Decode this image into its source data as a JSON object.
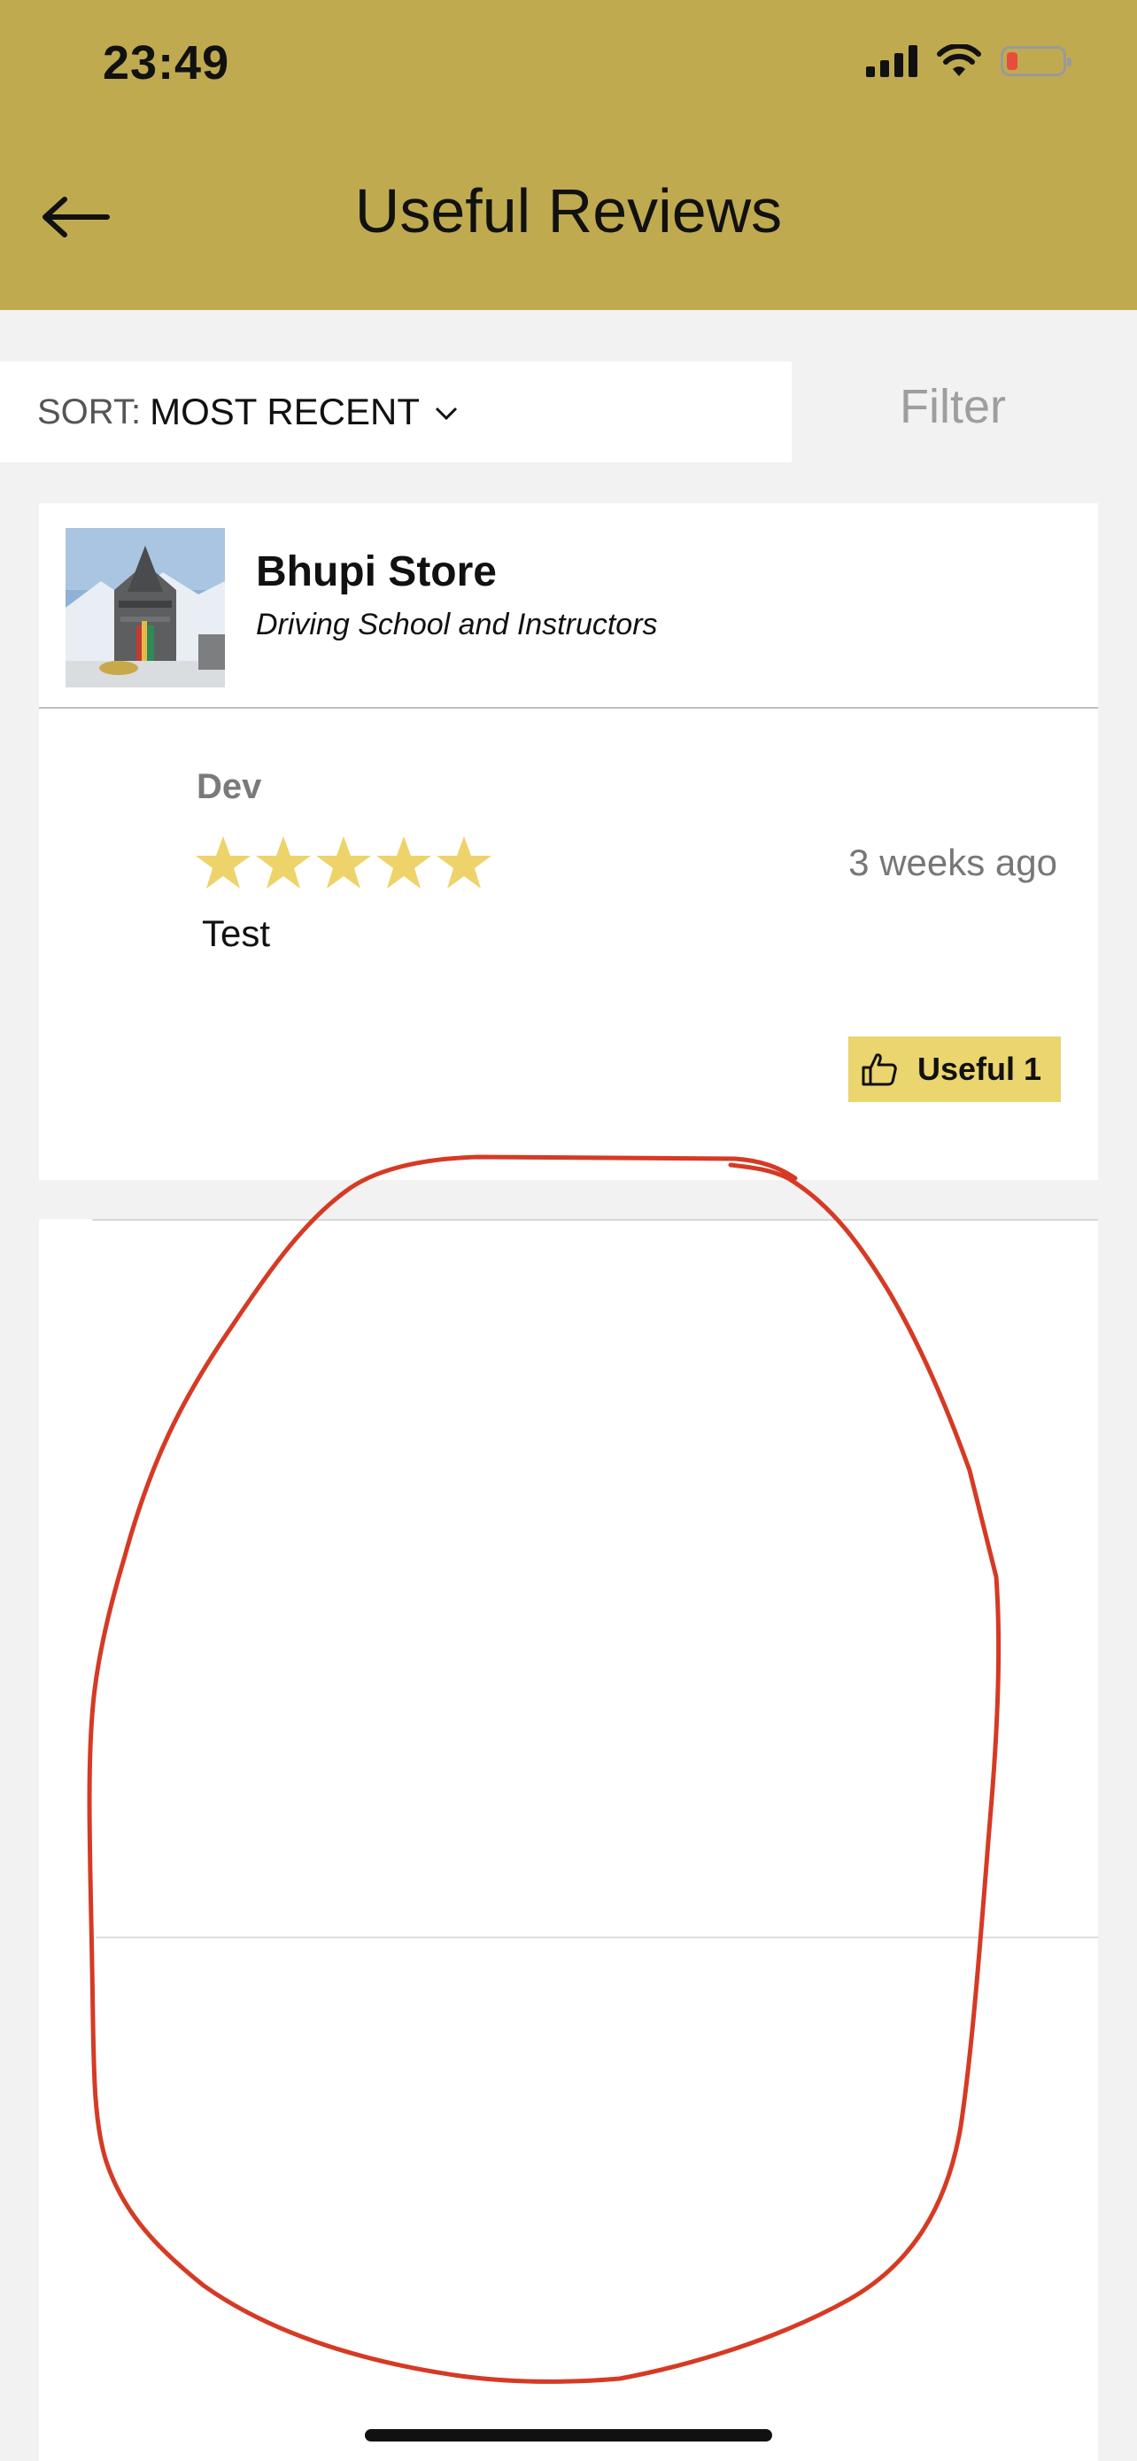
{
  "status_bar": {
    "time": "23:49",
    "icons": [
      "cellular-signal-icon",
      "wifi-icon",
      "battery-low-icon"
    ]
  },
  "header": {
    "title": "Useful Reviews",
    "back_icon": "arrow-left-icon",
    "background_color": "#bfaa50"
  },
  "toolbar": {
    "sort_prefix": "SORT:",
    "sort_value": "MOST RECENT",
    "filter_label": "Filter"
  },
  "store": {
    "name": "Bhupi Store",
    "category": "Driving School and Instructors"
  },
  "review": {
    "author": "Dev",
    "rating": 5,
    "max_rating": 5,
    "date": "3 weeks ago",
    "text": "Test",
    "useful_label": "Useful 1"
  },
  "colors": {
    "accent": "#bfaa50",
    "star": "#edd36a",
    "useful_button": "#ead56e",
    "annotation": "#d63a24"
  }
}
